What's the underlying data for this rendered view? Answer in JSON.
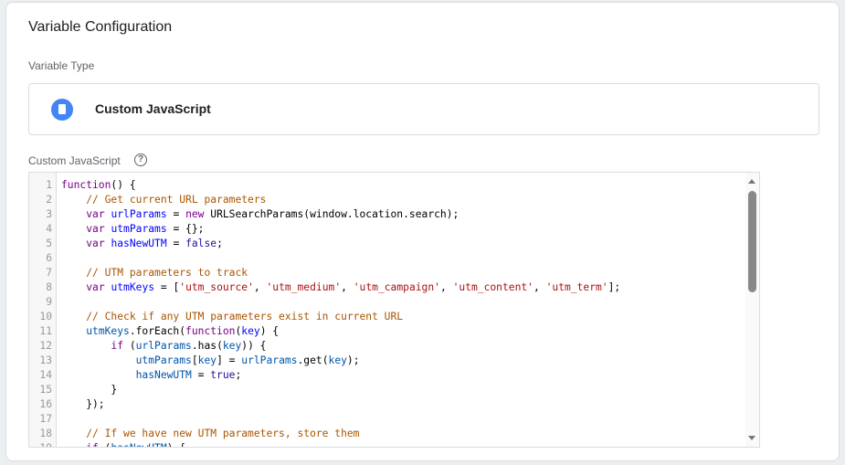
{
  "title": "Variable Configuration",
  "variable_type_label": "Variable Type",
  "variable_type": {
    "icon": "document-icon",
    "label": "Custom JavaScript",
    "icon_color": "#4285f4"
  },
  "code_label": "Custom JavaScript",
  "help_icon": "?",
  "code_lines": [
    [
      [
        "kw",
        "function"
      ],
      [
        "plain",
        "() {"
      ]
    ],
    [
      [
        "plain",
        "    "
      ],
      [
        "com",
        "// Get current URL parameters"
      ]
    ],
    [
      [
        "plain",
        "    "
      ],
      [
        "kw",
        "var"
      ],
      [
        "plain",
        " "
      ],
      [
        "def",
        "urlParams"
      ],
      [
        "plain",
        " = "
      ],
      [
        "kw",
        "new"
      ],
      [
        "plain",
        " URLSearchParams(window.location.search);"
      ]
    ],
    [
      [
        "plain",
        "    "
      ],
      [
        "kw",
        "var"
      ],
      [
        "plain",
        " "
      ],
      [
        "def",
        "utmParams"
      ],
      [
        "plain",
        " = {};"
      ]
    ],
    [
      [
        "plain",
        "    "
      ],
      [
        "kw",
        "var"
      ],
      [
        "plain",
        " "
      ],
      [
        "def",
        "hasNewUTM"
      ],
      [
        "plain",
        " = "
      ],
      [
        "atom",
        "false"
      ],
      [
        "plain",
        ";"
      ]
    ],
    [
      [
        "plain",
        ""
      ]
    ],
    [
      [
        "plain",
        "    "
      ],
      [
        "com",
        "// UTM parameters to track"
      ]
    ],
    [
      [
        "plain",
        "    "
      ],
      [
        "kw",
        "var"
      ],
      [
        "plain",
        " "
      ],
      [
        "def",
        "utmKeys"
      ],
      [
        "plain",
        " = ["
      ],
      [
        "str",
        "'utm_source'"
      ],
      [
        "plain",
        ", "
      ],
      [
        "str",
        "'utm_medium'"
      ],
      [
        "plain",
        ", "
      ],
      [
        "str",
        "'utm_campaign'"
      ],
      [
        "plain",
        ", "
      ],
      [
        "str",
        "'utm_content'"
      ],
      [
        "plain",
        ", "
      ],
      [
        "str",
        "'utm_term'"
      ],
      [
        "plain",
        "];"
      ]
    ],
    [
      [
        "plain",
        ""
      ]
    ],
    [
      [
        "plain",
        "    "
      ],
      [
        "com",
        "// Check if any UTM parameters exist in current URL"
      ]
    ],
    [
      [
        "plain",
        "    "
      ],
      [
        "var",
        "utmKeys"
      ],
      [
        "plain",
        ".forEach("
      ],
      [
        "kw",
        "function"
      ],
      [
        "plain",
        "("
      ],
      [
        "def",
        "key"
      ],
      [
        "plain",
        ") {"
      ]
    ],
    [
      [
        "plain",
        "        "
      ],
      [
        "kw",
        "if"
      ],
      [
        "plain",
        " ("
      ],
      [
        "var",
        "urlParams"
      ],
      [
        "plain",
        ".has("
      ],
      [
        "var",
        "key"
      ],
      [
        "plain",
        ")) {"
      ]
    ],
    [
      [
        "plain",
        "            "
      ],
      [
        "var",
        "utmParams"
      ],
      [
        "plain",
        "["
      ],
      [
        "var",
        "key"
      ],
      [
        "plain",
        "] = "
      ],
      [
        "var",
        "urlParams"
      ],
      [
        "plain",
        ".get("
      ],
      [
        "var",
        "key"
      ],
      [
        "plain",
        ");"
      ]
    ],
    [
      [
        "plain",
        "            "
      ],
      [
        "var",
        "hasNewUTM"
      ],
      [
        "plain",
        " = "
      ],
      [
        "atom",
        "true"
      ],
      [
        "plain",
        ";"
      ]
    ],
    [
      [
        "plain",
        "        }"
      ]
    ],
    [
      [
        "plain",
        "    });"
      ]
    ],
    [
      [
        "plain",
        ""
      ]
    ],
    [
      [
        "plain",
        "    "
      ],
      [
        "com",
        "// If we have new UTM parameters, store them"
      ]
    ],
    [
      [
        "plain",
        "    "
      ],
      [
        "kw",
        "if"
      ],
      [
        "plain",
        " ("
      ],
      [
        "var",
        "hasNewUTM"
      ],
      [
        "plain",
        ") {"
      ]
    ]
  ]
}
